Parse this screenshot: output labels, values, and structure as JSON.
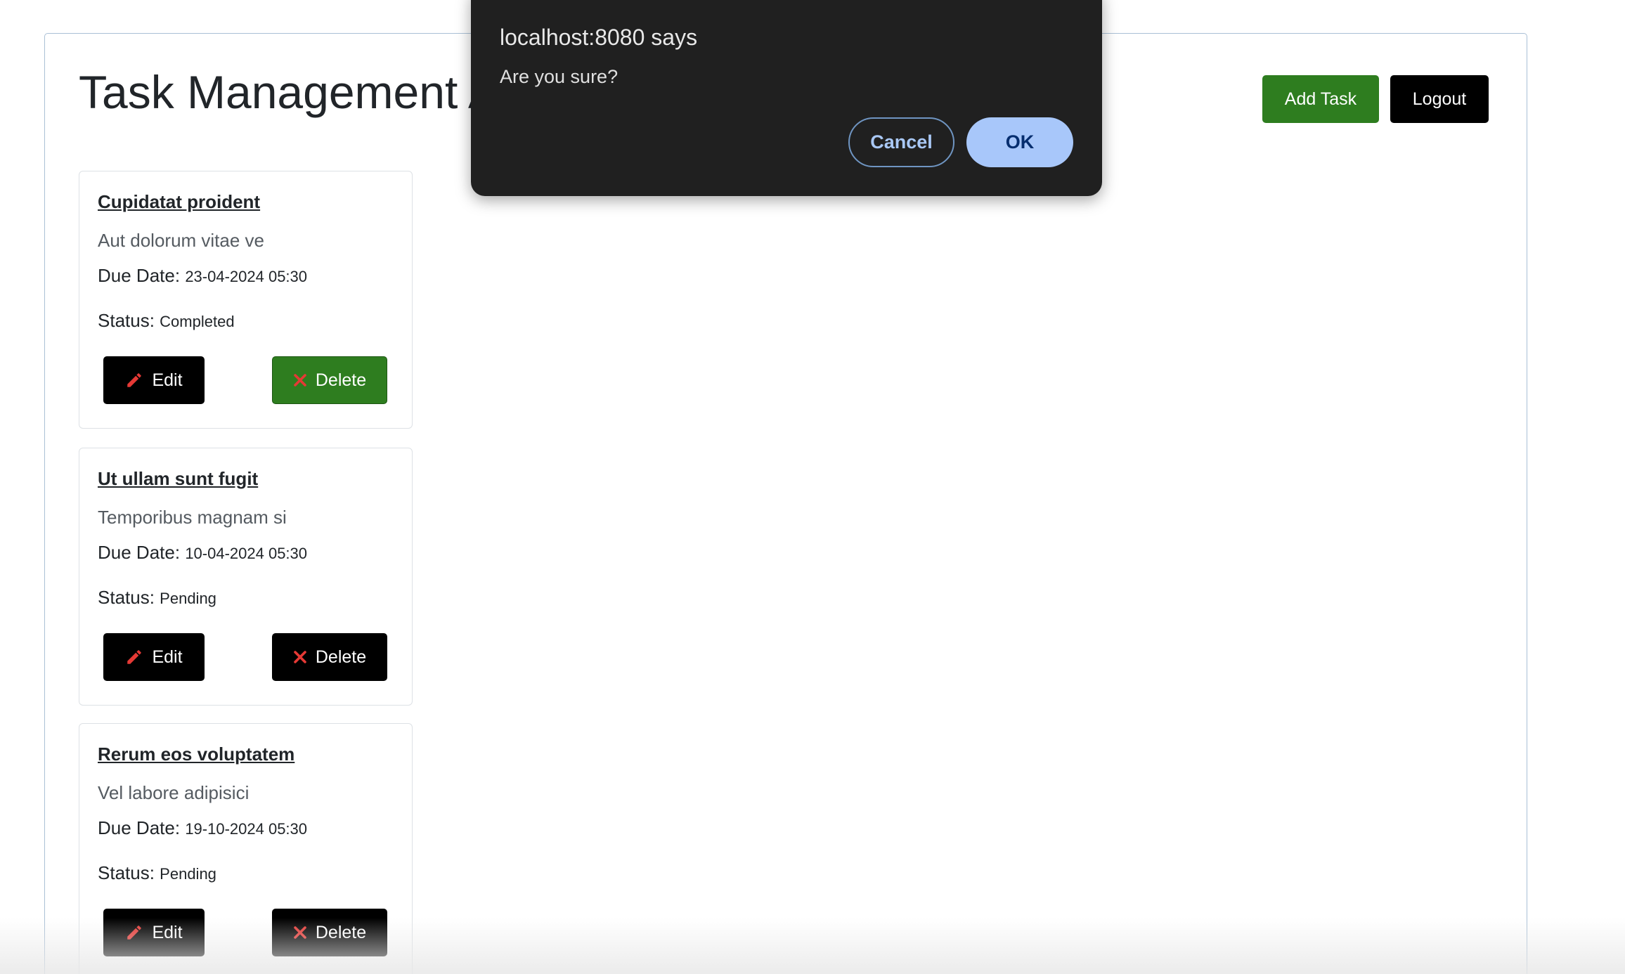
{
  "header": {
    "title": "Task Management A",
    "add_task_label": "Add Task",
    "logout_label": "Logout"
  },
  "tasks": [
    {
      "title": "Cupidatat proident",
      "description": "Aut dolorum vitae ve",
      "due_label": "Due Date:",
      "due_value": "23-04-2024 05:30",
      "status_label": "Status:",
      "status_value": "Completed",
      "edit_label": "Edit",
      "delete_label": "Delete"
    },
    {
      "title": "Ut ullam sunt fugit",
      "description": "Temporibus magnam si",
      "due_label": "Due Date:",
      "due_value": "10-04-2024 05:30",
      "status_label": "Status:",
      "status_value": "Pending",
      "edit_label": "Edit",
      "delete_label": "Delete"
    },
    {
      "title": "Rerum eos voluptatem",
      "description": "Vel labore adipisici",
      "due_label": "Due Date:",
      "due_value": "19-10-2024 05:30",
      "status_label": "Status:",
      "status_value": "Pending",
      "edit_label": "Edit",
      "delete_label": "Delete"
    }
  ],
  "dialog": {
    "title": "localhost:8080 says",
    "message": "Are you sure?",
    "cancel_label": "Cancel",
    "ok_label": "OK"
  },
  "icons": {
    "edit": "pencil-icon",
    "delete": "x-icon"
  },
  "colors": {
    "add_task_bg": "#2e7d1f",
    "logout_bg": "#000000",
    "icon_red": "#e53935",
    "dialog_bg": "#202020",
    "ok_bg": "#a8c7fa"
  }
}
